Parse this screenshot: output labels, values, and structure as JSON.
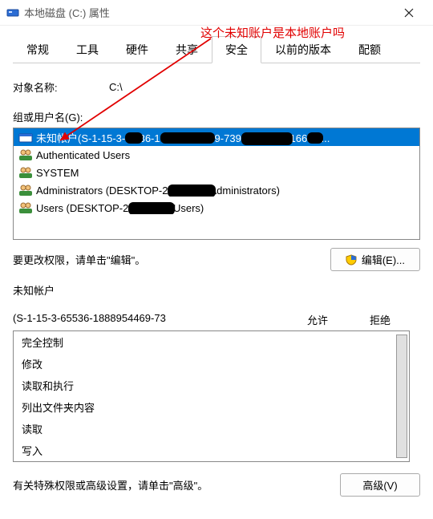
{
  "titlebar": {
    "text": "本地磁盘 (C:) 属性"
  },
  "annotation": {
    "text": "这个未知账户是本地账户吗"
  },
  "tabs": {
    "general": "常规",
    "tools": "工具",
    "hardware": "硬件",
    "sharing": "共享",
    "security": "安全",
    "prev": "以前的版本",
    "quota": "配额"
  },
  "object": {
    "label": "对象名称:",
    "value": "C:\\"
  },
  "groups_label": "组或用户名(G):",
  "users": [
    {
      "label": "未知帐户(S-1-15-3-███36-1███████69-73██████166██..."
    },
    {
      "label": "Authenticated Users"
    },
    {
      "label": "SYSTEM"
    },
    {
      "label": "Administrators (DESKTOP-2██████Administrators)"
    },
    {
      "label": "Users (DESKTOP-2██████\\Users)"
    }
  ],
  "edit": {
    "hint": "要更改权限，请单击\"编辑\"。",
    "btn": "编辑(E)..."
  },
  "perm": {
    "title1": "未知帐户",
    "title2": "(S-1-15-3-65536-1888954469-73",
    "allow": "允许",
    "deny": "拒绝"
  },
  "perm_items": [
    "完全控制",
    "修改",
    "读取和执行",
    "列出文件夹内容",
    "读取",
    "写入"
  ],
  "adv": {
    "hint": "有关特殊权限或高级设置，请单击\"高级\"。",
    "btn": "高级(V)"
  }
}
